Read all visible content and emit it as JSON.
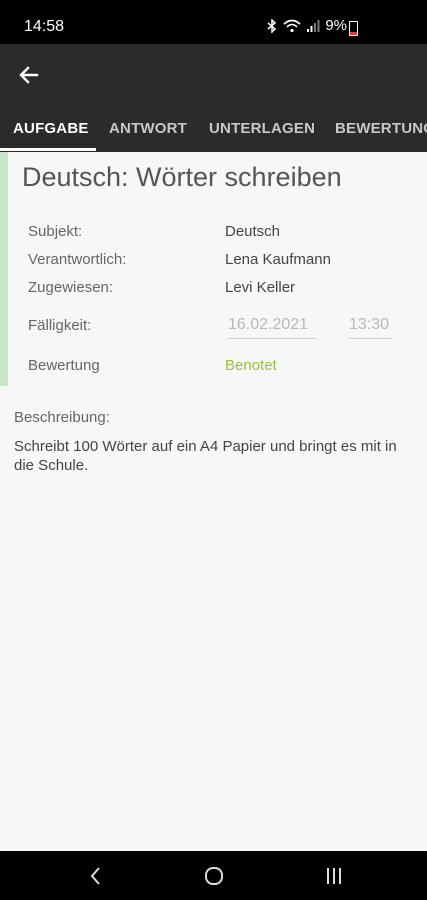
{
  "status_bar": {
    "time": "14:58",
    "battery_percent": "9%",
    "icons": [
      "bluetooth-icon",
      "wifi-icon",
      "signal-icon",
      "battery-icon"
    ]
  },
  "app_bar": {
    "tabs": [
      {
        "label": "AUFGABE",
        "active": true
      },
      {
        "label": "ANTWORT",
        "active": false
      },
      {
        "label": "UNTERLAGEN",
        "active": false
      },
      {
        "label": "BEWERTUNG",
        "active": false
      }
    ]
  },
  "task": {
    "title": "Deutsch: Wörter schreiben",
    "fields": {
      "subject_label": "Subjekt:",
      "subject_value": "Deutsch",
      "responsible_label": "Verantwortlich:",
      "responsible_value": "Lena Kaufmann",
      "assigned_label": "Zugewiesen:",
      "assigned_value": "Levi Keller",
      "due_label": "Fälligkeit:",
      "due_date": "16.02.2021",
      "due_time": "13:30",
      "grading_label": "Bewertung",
      "grading_value": "Benotet"
    },
    "description_label": "Beschreibung:",
    "description": "Schreibt 100 Wörter auf ein A4 Papier und bringt es mit in die Schule."
  },
  "colors": {
    "app_bar": "#2b2b2b",
    "accent_bar": "#c9e7c9",
    "grade": "#9ac23c"
  },
  "nav_bar": {
    "buttons": [
      "back-nav-icon",
      "home-nav-icon",
      "recents-nav-icon"
    ]
  }
}
